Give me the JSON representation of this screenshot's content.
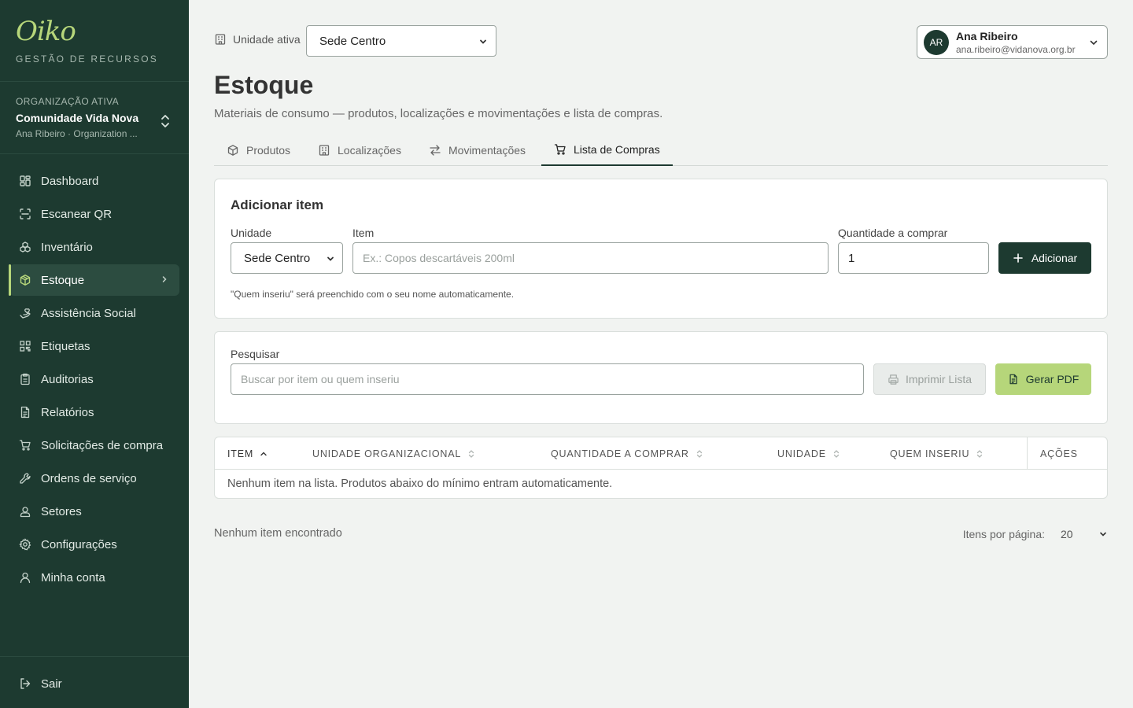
{
  "brand": {
    "logo": "Oiko",
    "subtitle": "GESTÃO DE RECURSOS"
  },
  "org": {
    "label": "ORGANIZAÇÃO ATIVA",
    "name": "Comunidade Vida Nova",
    "user_line": "Ana Ribeiro · Organization ..."
  },
  "nav": {
    "items": [
      {
        "label": "Dashboard",
        "icon": "grid-icon"
      },
      {
        "label": "Escanear QR",
        "icon": "scan-icon"
      },
      {
        "label": "Inventário",
        "icon": "boxes-icon"
      },
      {
        "label": "Estoque",
        "icon": "package-icon",
        "active": true
      },
      {
        "label": "Assistência Social",
        "icon": "hand-heart-icon"
      },
      {
        "label": "Etiquetas",
        "icon": "qr-code-icon"
      },
      {
        "label": "Auditorias",
        "icon": "clipboard-icon"
      },
      {
        "label": "Relatórios",
        "icon": "file-text-icon"
      },
      {
        "label": "Solicitações de compra",
        "icon": "cart-icon"
      },
      {
        "label": "Ordens de serviço",
        "icon": "wrench-icon"
      },
      {
        "label": "Setores",
        "icon": "user-square-icon"
      },
      {
        "label": "Configurações",
        "icon": "gear-icon"
      },
      {
        "label": "Minha conta",
        "icon": "user-icon"
      }
    ],
    "logout": "Sair"
  },
  "topbar": {
    "unit_label": "Unidade ativa",
    "unit_value": "Sede Centro",
    "user": {
      "initials": "AR",
      "name": "Ana Ribeiro",
      "email": "ana.ribeiro@vidanova.org.br"
    }
  },
  "page": {
    "title": "Estoque",
    "subtitle": "Materiais de consumo — produtos, localizações e movimentações e lista de compras."
  },
  "tabs": [
    {
      "label": "Produtos",
      "icon": "package-icon"
    },
    {
      "label": "Localizações",
      "icon": "building-icon"
    },
    {
      "label": "Movimentações",
      "icon": "arrows-exchange-icon"
    },
    {
      "label": "Lista de Compras",
      "icon": "cart-icon",
      "active": true
    }
  ],
  "add_form": {
    "title": "Adicionar item",
    "unit_label": "Unidade",
    "unit_value": "Sede Centro",
    "item_label": "Item",
    "item_placeholder": "Ex.: Copos descartáveis 200ml",
    "qty_label": "Quantidade a comprar",
    "qty_value": "1",
    "add_button": "Adicionar",
    "hint": "\"Quem inseriu\" será preenchido com o seu nome automaticamente."
  },
  "search": {
    "label": "Pesquisar",
    "placeholder": "Buscar por item ou quem inseriu",
    "print_button": "Imprimir Lista",
    "pdf_button": "Gerar PDF"
  },
  "table": {
    "columns": [
      "ITEM",
      "UNIDADE ORGANIZACIONAL",
      "QUANTIDADE A COMPRAR",
      "UNIDADE",
      "QUEM INSERIU",
      "AÇÕES"
    ],
    "sorted_column": "ITEM",
    "empty_message": "Nenhum item na lista. Produtos abaixo do mínimo entram automaticamente."
  },
  "footer": {
    "status": "Nenhum item encontrado",
    "per_page_label": "Itens por página:",
    "per_page_value": "20"
  },
  "colors": {
    "sidebar": "#1d3a30",
    "accent": "#b6d67a",
    "background": "#f1f3f1"
  }
}
